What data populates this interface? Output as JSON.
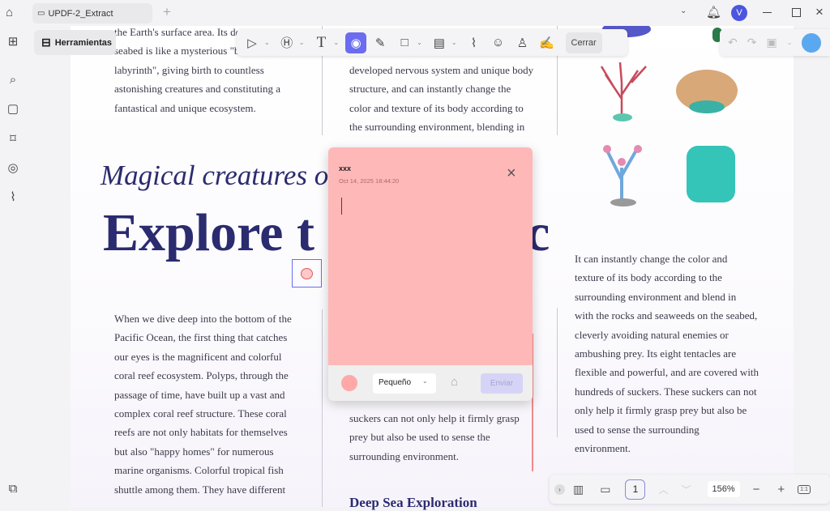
{
  "titlebar": {
    "tab_title": "UPDF-2_Extract",
    "new_tab": "+",
    "avatar_letter": "V"
  },
  "toolbar": {
    "tools_label": "Herramientas",
    "close_label": "Cerrar"
  },
  "document": {
    "left_top": [
      "the Earth's surface area. Its de",
      "seabed is like a mysterious \"b",
      "labyrinth\", giving birth to countless",
      "astonishing creatures and constituting a",
      "fantastical and unique ecosystem."
    ],
    "middle_top": [
      "developed nervous system and unique body",
      "structure, and can instantly change the",
      "color and texture of its body according to",
      "the surrounding environment, blending in"
    ],
    "subtitle": "Magical creatures o",
    "headline_left": "Explore t",
    "headline_right": "c",
    "left_body": [
      "When we dive deep into the bottom of the",
      "Pacific Ocean, the first thing that catches",
      "our eyes is the magnificent and colorful",
      "coral reef ecosystem. Polyps, through the",
      "passage of time, have built up a vast and",
      "complex coral reef structure. These coral",
      "reefs are not only habitats for themselves",
      "but also \"happy homes\" for numerous",
      "marine organisms. Colorful tropical fish",
      "shuttle among them. They have different"
    ],
    "middle_body": [
      "suckers can not only help it firmly grasp",
      "prey but also be used to sense the",
      "surrounding environment."
    ],
    "middle_heading": "Deep Sea Exploration",
    "right_body": [
      "It can instantly change the color and",
      "texture of its body according to the",
      "surrounding environment and blend in",
      "with the rocks and seaweeds on the seabed,",
      "cleverly avoiding natural enemies or",
      "ambushing prey. Its eight tentacles are",
      "flexible and powerful, and are covered with",
      "hundreds of suckers. These suckers can not",
      "only help it firmly grasp prey but also be",
      "used to sense the surrounding",
      "environment."
    ]
  },
  "note_popup": {
    "author": "xxx",
    "timestamp": "Oct 14, 2025 18:44:20",
    "text_value": "",
    "size_option": "Pequeño",
    "send_label": "Enviar",
    "color": "#ffb8b8"
  },
  "bottombar": {
    "page_number": "1",
    "zoom": "156%",
    "fit_label": "1:1"
  },
  "colors": {
    "accent": "#6b6cf0",
    "headline": "#2b2b70"
  }
}
